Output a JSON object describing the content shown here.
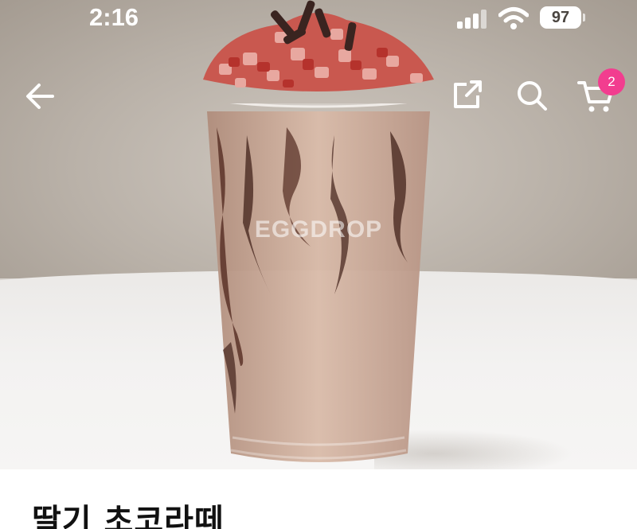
{
  "status_bar": {
    "time": "2:16",
    "battery": "97"
  },
  "header": {
    "back_icon": "arrow-left-icon",
    "share_icon": "share-out-icon",
    "search_icon": "search-icon",
    "cart_icon": "cart-icon",
    "cart_count": "2"
  },
  "hero": {
    "watermark": "EGGDROP"
  },
  "product": {
    "title": "딸기 초코라떼"
  },
  "colors": {
    "badge": "#f23d8f",
    "icon": "#ffffff"
  }
}
